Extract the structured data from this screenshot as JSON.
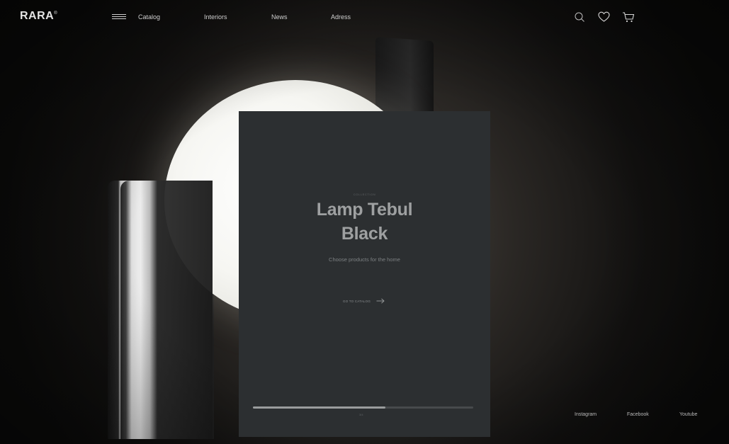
{
  "brand": {
    "name": "RARA",
    "mark": "®"
  },
  "nav": {
    "menu_icon": "hamburger-icon",
    "items": [
      {
        "label": "Catalog"
      },
      {
        "label": "Interiors"
      },
      {
        "label": "News"
      },
      {
        "label": "Adress"
      }
    ]
  },
  "header_icons": [
    "search-icon",
    "heart-icon",
    "cart-icon"
  ],
  "hero": {
    "kicker": "COLLECTION",
    "title_line1": "Lamp Tebul",
    "title_line2": "Black",
    "subtitle": "Choose products for the home",
    "cta_label": "GO TO CATALOG",
    "cta_icon": "arrow-right-icon",
    "progress": 0.6,
    "counter": "3/4"
  },
  "social": [
    {
      "label": "Instagram"
    },
    {
      "label": "Facebook"
    },
    {
      "label": "Youtube"
    }
  ],
  "colors": {
    "card": "#2c2f31",
    "background": "#0e0d0c",
    "text": "#cfcfcf"
  }
}
